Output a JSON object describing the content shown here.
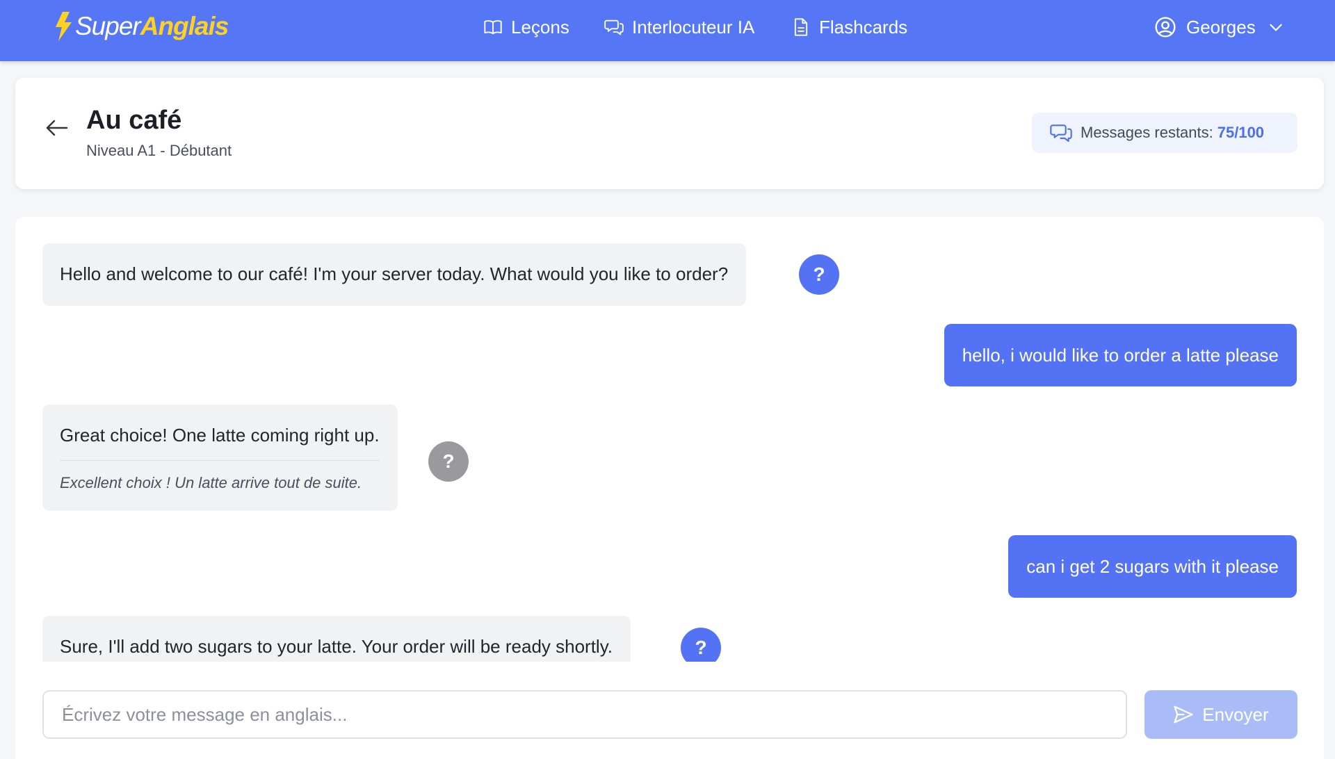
{
  "header": {
    "logo": {
      "part1": "Super",
      "part2": "Anglais",
      "icon": "lightning-bolt-icon"
    },
    "nav": [
      {
        "label": "Leçons",
        "icon": "book-icon"
      },
      {
        "label": "Interlocuteur IA",
        "icon": "chat-bubbles-icon"
      },
      {
        "label": "Flashcards",
        "icon": "document-icon"
      }
    ],
    "user": {
      "name": "Georges",
      "icon": "user-circle-icon"
    }
  },
  "conversation": {
    "title": "Au café",
    "subtitle": "Niveau A1 - Débutant",
    "messages_remaining_label": "Messages restants:",
    "messages_remaining_value": "75/100"
  },
  "messages": [
    {
      "role": "ai",
      "text": "Hello and welcome to our café! I'm your server today. What would you like to order?"
    },
    {
      "role": "user",
      "text": "hello, i would like to order a latte please"
    },
    {
      "role": "ai",
      "text": "Great choice! One latte coming right up.",
      "translation": "Excellent choix ! Un latte arrive tout de suite."
    },
    {
      "role": "user",
      "text": "can i get 2 sugars with it please"
    },
    {
      "role": "ai",
      "text": "Sure, I'll add two sugars to your latte. Your order will be ready shortly."
    }
  ],
  "help_label": "?",
  "composer": {
    "placeholder": "Écrivez votre message en anglais...",
    "send_label": "Envoyer"
  },
  "colors": {
    "primary": "#5577f5",
    "accent_yellow": "#ffd21f",
    "user_bubble": "#5472f4",
    "send_disabled": "#a9bcf8"
  }
}
